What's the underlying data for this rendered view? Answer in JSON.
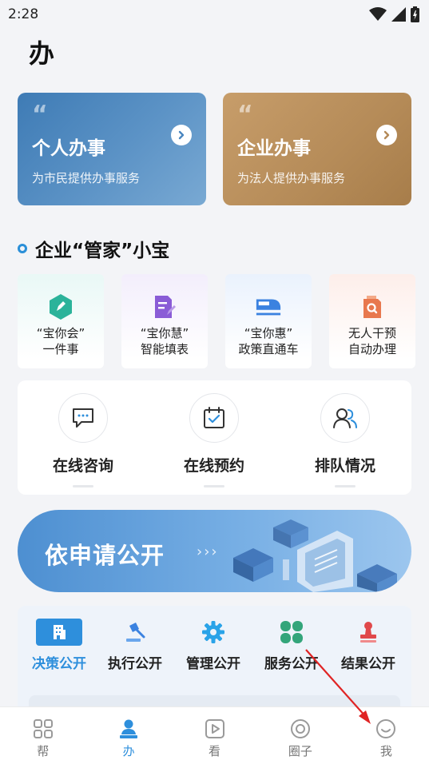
{
  "status_bar": {
    "time": "2:28"
  },
  "page_title": "办",
  "hero_cards": [
    {
      "title": "个人办事",
      "subtitle": "为市民提供办事服务"
    },
    {
      "title": "企业办事",
      "subtitle": "为法人提供办事服务"
    }
  ],
  "section": {
    "title": "企业“管家”小宝"
  },
  "feature_tiles": [
    {
      "line1": "“宝你会”",
      "line2": "一件事",
      "icon": "hexagon-pen-icon",
      "color": "#2bb39a"
    },
    {
      "line1": "“宝你慧”",
      "line2": "智能填表",
      "icon": "form-edit-icon",
      "color": "#8a5cd6"
    },
    {
      "line1": "“宝你惠”",
      "line2": "政策直通车",
      "icon": "train-icon",
      "color": "#3b82e0"
    },
    {
      "line1": "无人干预",
      "line2": "自动办理",
      "icon": "document-search-icon",
      "color": "#e8784e"
    }
  ],
  "services": [
    {
      "label": "在线咨询",
      "icon": "chat-icon"
    },
    {
      "label": "在线预约",
      "icon": "calendar-check-icon"
    },
    {
      "label": "排队情况",
      "icon": "people-icon"
    }
  ],
  "banner": {
    "text": "依申请公开",
    "chevrons": "›››"
  },
  "public_tabs": [
    {
      "label": "决策公开",
      "icon": "building-icon",
      "active": true
    },
    {
      "label": "执行公开",
      "icon": "gavel-icon",
      "active": false
    },
    {
      "label": "管理公开",
      "icon": "gear-icon",
      "active": false
    },
    {
      "label": "服务公开",
      "icon": "clover-icon",
      "active": false
    },
    {
      "label": "结果公开",
      "icon": "stamp-icon",
      "active": false
    }
  ],
  "bottom_nav": [
    {
      "label": "帮",
      "icon": "grid-icon",
      "active": false
    },
    {
      "label": "办",
      "icon": "person-desk-icon",
      "active": true
    },
    {
      "label": "看",
      "icon": "play-icon",
      "active": false
    },
    {
      "label": "圈子",
      "icon": "circle-target-icon",
      "active": false
    },
    {
      "label": "我",
      "icon": "smile-icon",
      "active": false
    }
  ],
  "colors": {
    "accent": "#2e8fdc",
    "annotation": "#e02424"
  }
}
